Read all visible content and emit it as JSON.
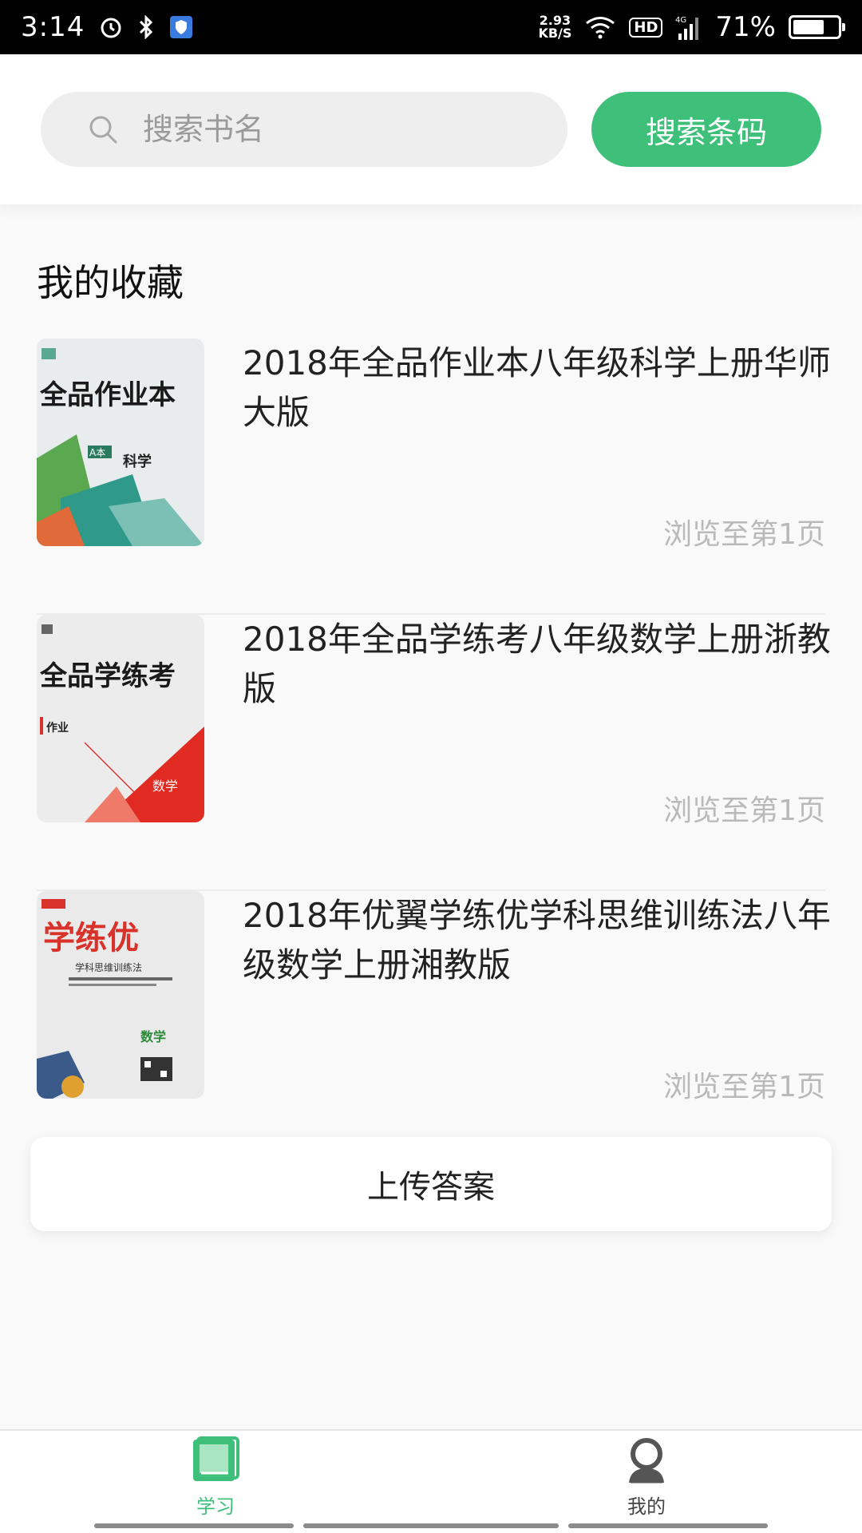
{
  "status_bar": {
    "time": "3:14",
    "net_speed_value": "2.93",
    "net_speed_unit": "KB/S",
    "hd": "HD",
    "signal_type": "4G",
    "battery": "71%",
    "battery_level": 0.71
  },
  "search": {
    "placeholder": "搜索书名",
    "barcode_button": "搜索条码"
  },
  "favorites": {
    "title": "我的收藏",
    "books": [
      {
        "title": "2018年全品作业本八年级科学上册华师大版",
        "progress": "浏览至第1页",
        "cover_brand": "全品作业本",
        "cover_subject": "科学",
        "cover_badge": "A本"
      },
      {
        "title": "2018年全品学练考八年级数学上册浙教版",
        "progress": "浏览至第1页",
        "cover_brand": "全品学练考",
        "cover_subject": "数学",
        "cover_badge": "作业"
      },
      {
        "title": "2018年优翼学练优学科思维训练法八年级数学上册湘教版",
        "progress": "浏览至第1页",
        "cover_brand": "学练优",
        "cover_subject": "数学",
        "cover_badge": "学科思维训练法"
      }
    ]
  },
  "upload_button": "上传答案",
  "bottom_nav": {
    "study": "学习",
    "mine": "我的"
  },
  "colors": {
    "accent": "#3fc07a",
    "progress_text": "#b9b9b9"
  }
}
